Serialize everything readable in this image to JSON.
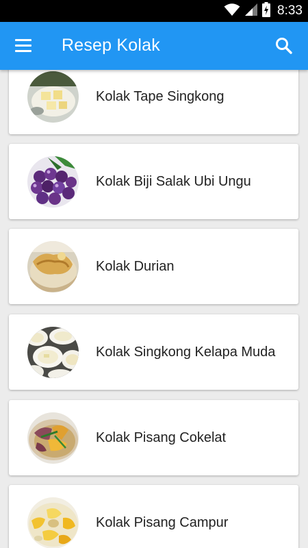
{
  "status_bar": {
    "time": "8:33"
  },
  "app_bar": {
    "title": "Resep Kolak",
    "menu_icon": "hamburger-menu-icon",
    "search_icon": "search-icon",
    "color": "#2196f3"
  },
  "recipes": [
    {
      "label": "Kolak Tape Singkong",
      "image": "kolak-tape-singkong-photo"
    },
    {
      "label": "Kolak Biji Salak Ubi Ungu",
      "image": "kolak-biji-salak-ubi-ungu-photo"
    },
    {
      "label": "Kolak Durian",
      "image": "kolak-durian-photo"
    },
    {
      "label": "Kolak Singkong Kelapa Muda",
      "image": "kolak-singkong-kelapa-muda-photo"
    },
    {
      "label": "Kolak Pisang Cokelat",
      "image": "kolak-pisang-cokelat-photo"
    },
    {
      "label": "Kolak Pisang Campur",
      "image": "kolak-pisang-campur-photo"
    }
  ]
}
